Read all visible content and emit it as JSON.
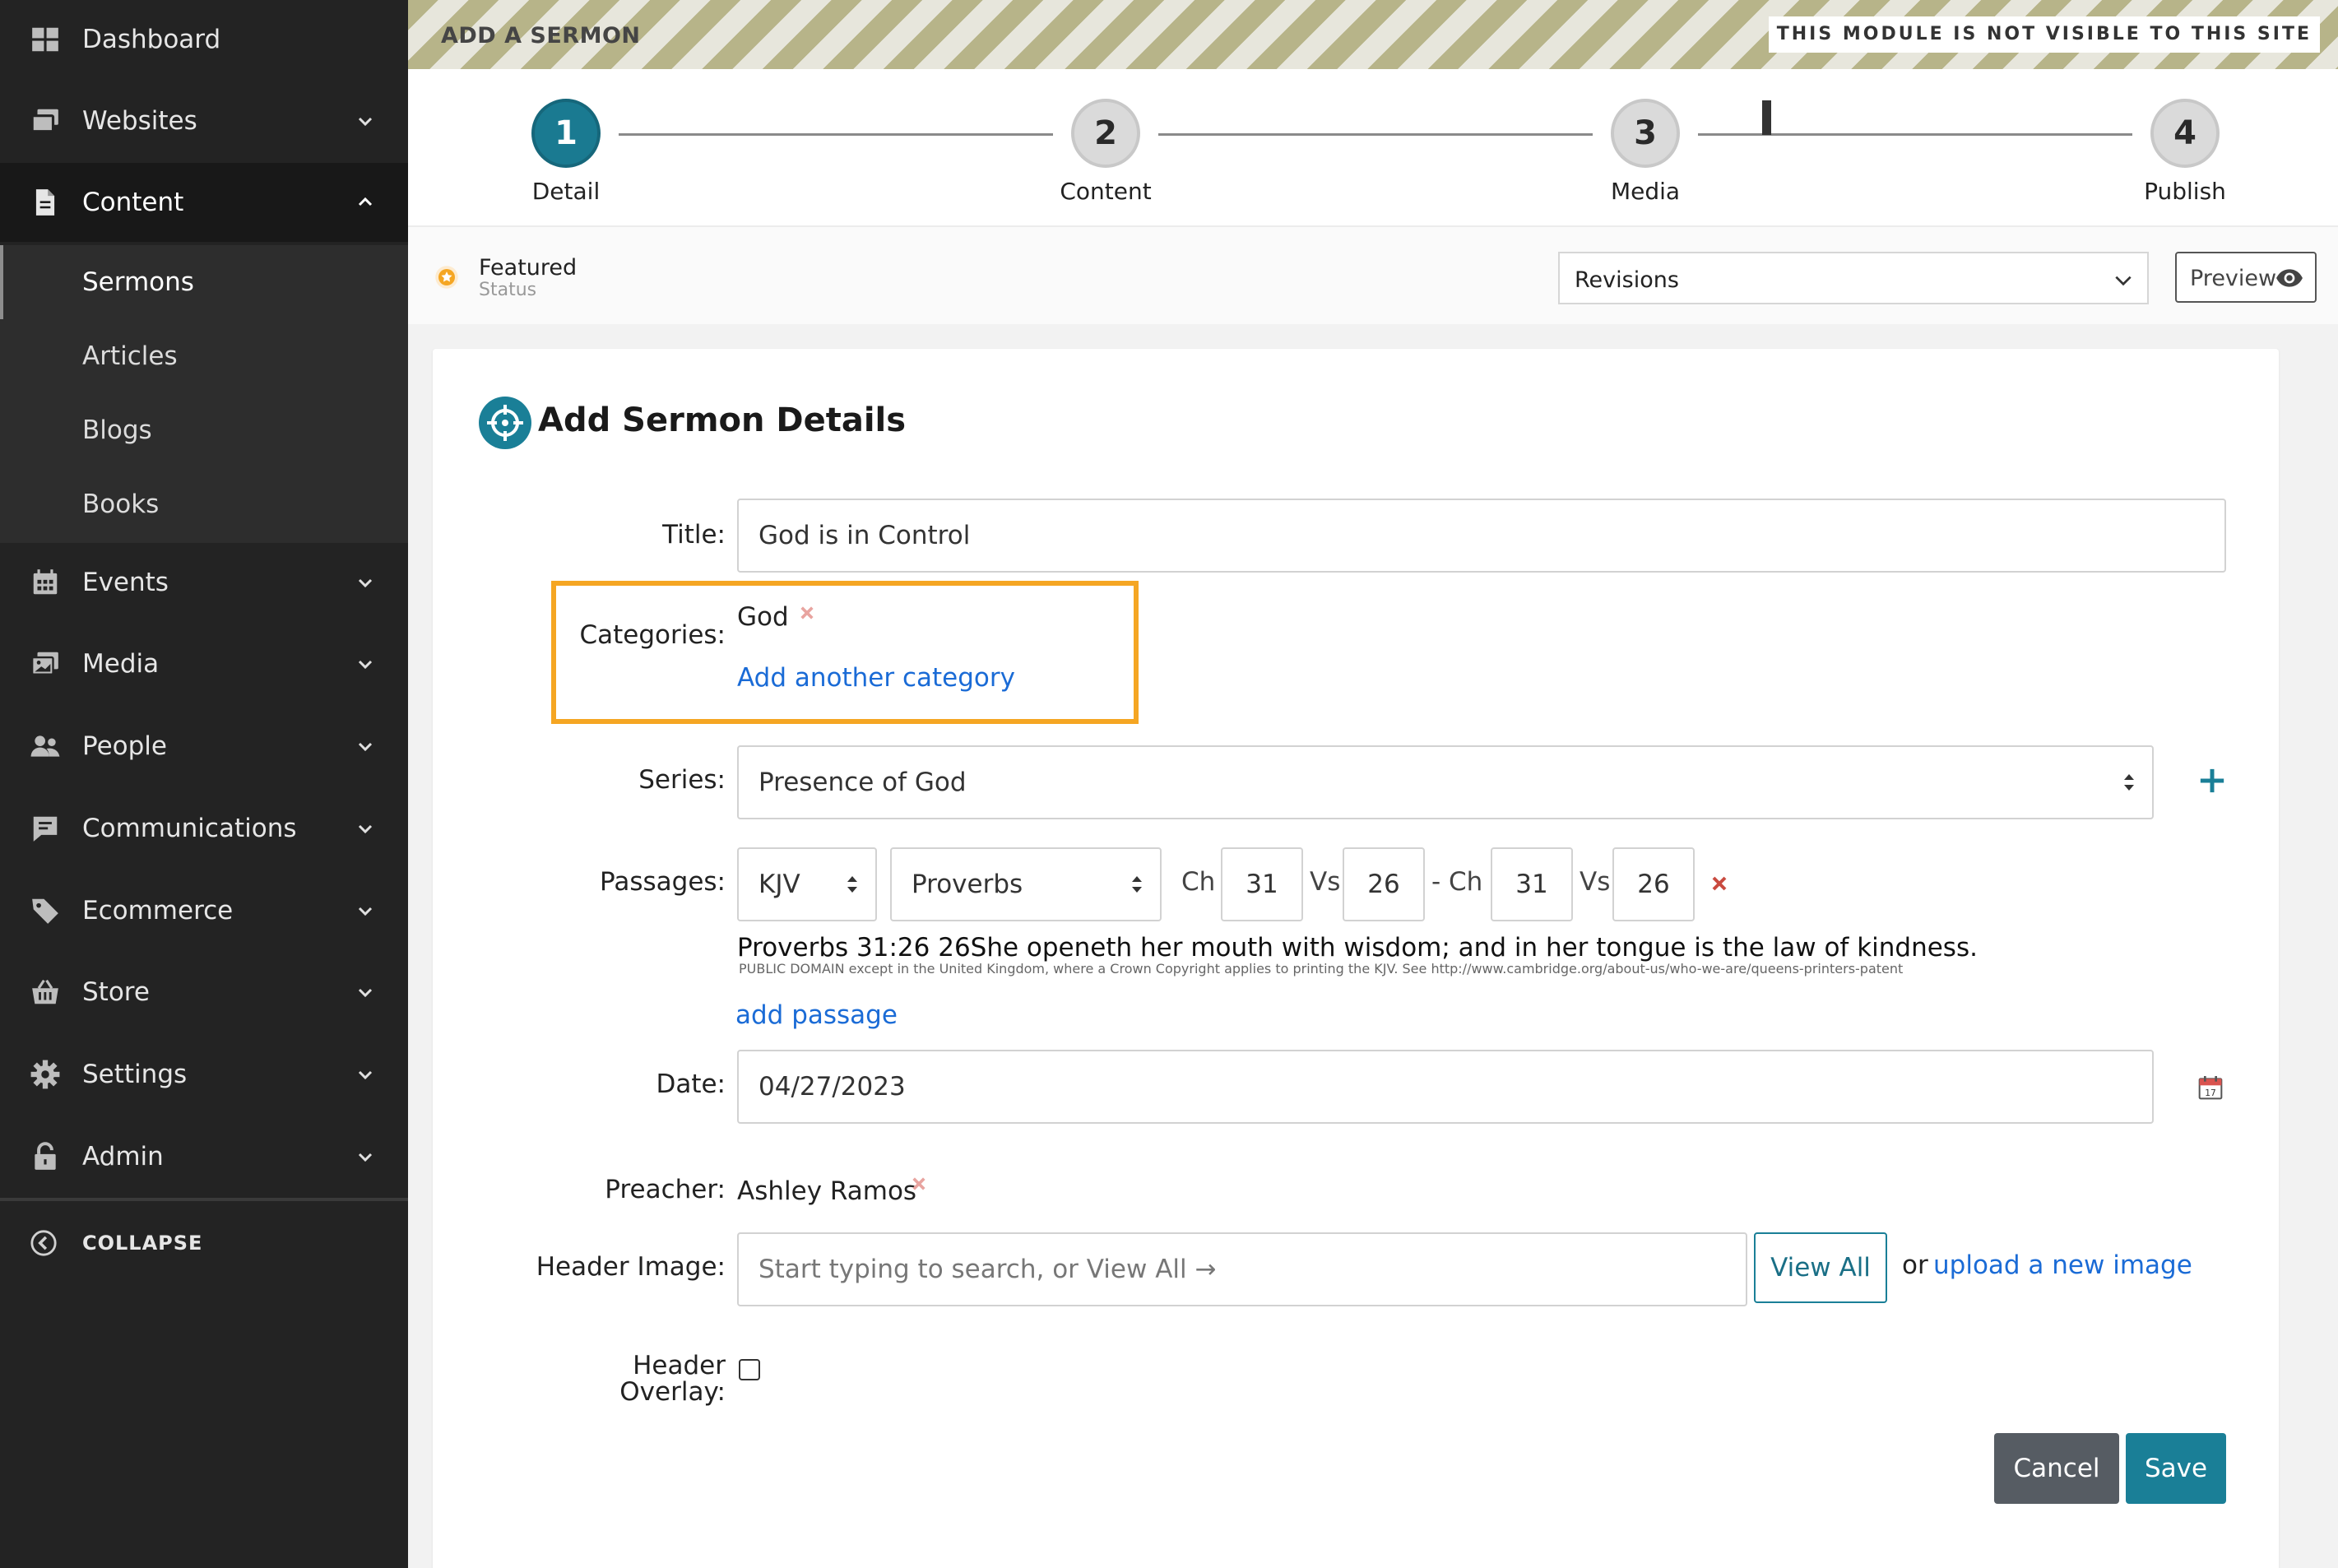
{
  "sidebar": {
    "items": [
      {
        "label": "Dashboard",
        "icon": "dashboard-icon",
        "has_chevron": false
      },
      {
        "label": "Websites",
        "icon": "websites-icon",
        "has_chevron": true
      },
      {
        "label": "Content",
        "icon": "document-icon",
        "has_chevron": true,
        "expanded": true
      },
      {
        "label": "Events",
        "icon": "calendar-icon",
        "has_chevron": true
      },
      {
        "label": "Media",
        "icon": "media-icon",
        "has_chevron": true
      },
      {
        "label": "People",
        "icon": "people-icon",
        "has_chevron": true
      },
      {
        "label": "Communications",
        "icon": "chat-icon",
        "has_chevron": true
      },
      {
        "label": "Ecommerce",
        "icon": "tag-icon",
        "has_chevron": true
      },
      {
        "label": "Store",
        "icon": "basket-icon",
        "has_chevron": true
      },
      {
        "label": "Settings",
        "icon": "gear-icon",
        "has_chevron": true
      },
      {
        "label": "Admin",
        "icon": "lock-icon",
        "has_chevron": true
      }
    ],
    "content_subitems": [
      "Sermons",
      "Articles",
      "Blogs",
      "Books"
    ],
    "active_subitem": "Sermons",
    "collapse_label": "COLLAPSE"
  },
  "banner": {
    "title": "ADD A SERMON",
    "notice": "THIS MODULE IS NOT VISIBLE TO THIS SITE"
  },
  "stepper": {
    "steps": [
      {
        "number": "1",
        "label": "Detail",
        "active": true
      },
      {
        "number": "2",
        "label": "Content",
        "active": false
      },
      {
        "number": "3",
        "label": "Media",
        "active": false
      },
      {
        "number": "4",
        "label": "Publish",
        "active": false
      }
    ]
  },
  "status": {
    "featured_label": "Featured",
    "status_label": "Status",
    "revisions_value": "Revisions",
    "preview_label": "Preview"
  },
  "form": {
    "heading": "Add Sermon Details",
    "title_label": "Title:",
    "title_value": "God is in Control",
    "categories_label": "Categories:",
    "category_value": "God",
    "add_category_link": "Add another category",
    "series_label": "Series:",
    "series_value": "Presence of God",
    "passages_label": "Passages:",
    "passage": {
      "version": "KJV",
      "book": "Proverbs",
      "ch_label": "Ch",
      "vs_label": "Vs",
      "to_ch_label": "- Ch",
      "start_ch": "31",
      "start_vs": "26",
      "end_ch": "31",
      "end_vs": "26"
    },
    "verse_text": "Proverbs 31:26 26She openeth her mouth with wisdom; and in her tongue is the law of kindness.",
    "verse_copyright": "PUBLIC DOMAIN except in the United Kingdom, where a Crown Copyright applies to printing the KJV. See http://www.cambridge.org/about-us/who-we-are/queens-printers-patent",
    "add_passage_link": "add passage",
    "date_label": "Date:",
    "date_value": "04/27/2023",
    "preacher_label": "Preacher:",
    "preacher_value": "Ashley Ramos",
    "header_image_label": "Header Image:",
    "header_image_placeholder": "Start typing to search, or View All →",
    "view_all_label": "View All",
    "or_text": "or",
    "upload_link": "upload a new image",
    "header_overlay_label_1": "Header",
    "header_overlay_label_2": "Overlay:",
    "cancel_label": "Cancel",
    "save_label": "Save"
  },
  "colors": {
    "accent": "#1a7f97",
    "sidebar_bg": "#232323",
    "link": "#1a6bd6",
    "highlight": "#f5a623",
    "remove_red": "#c94a3f"
  }
}
